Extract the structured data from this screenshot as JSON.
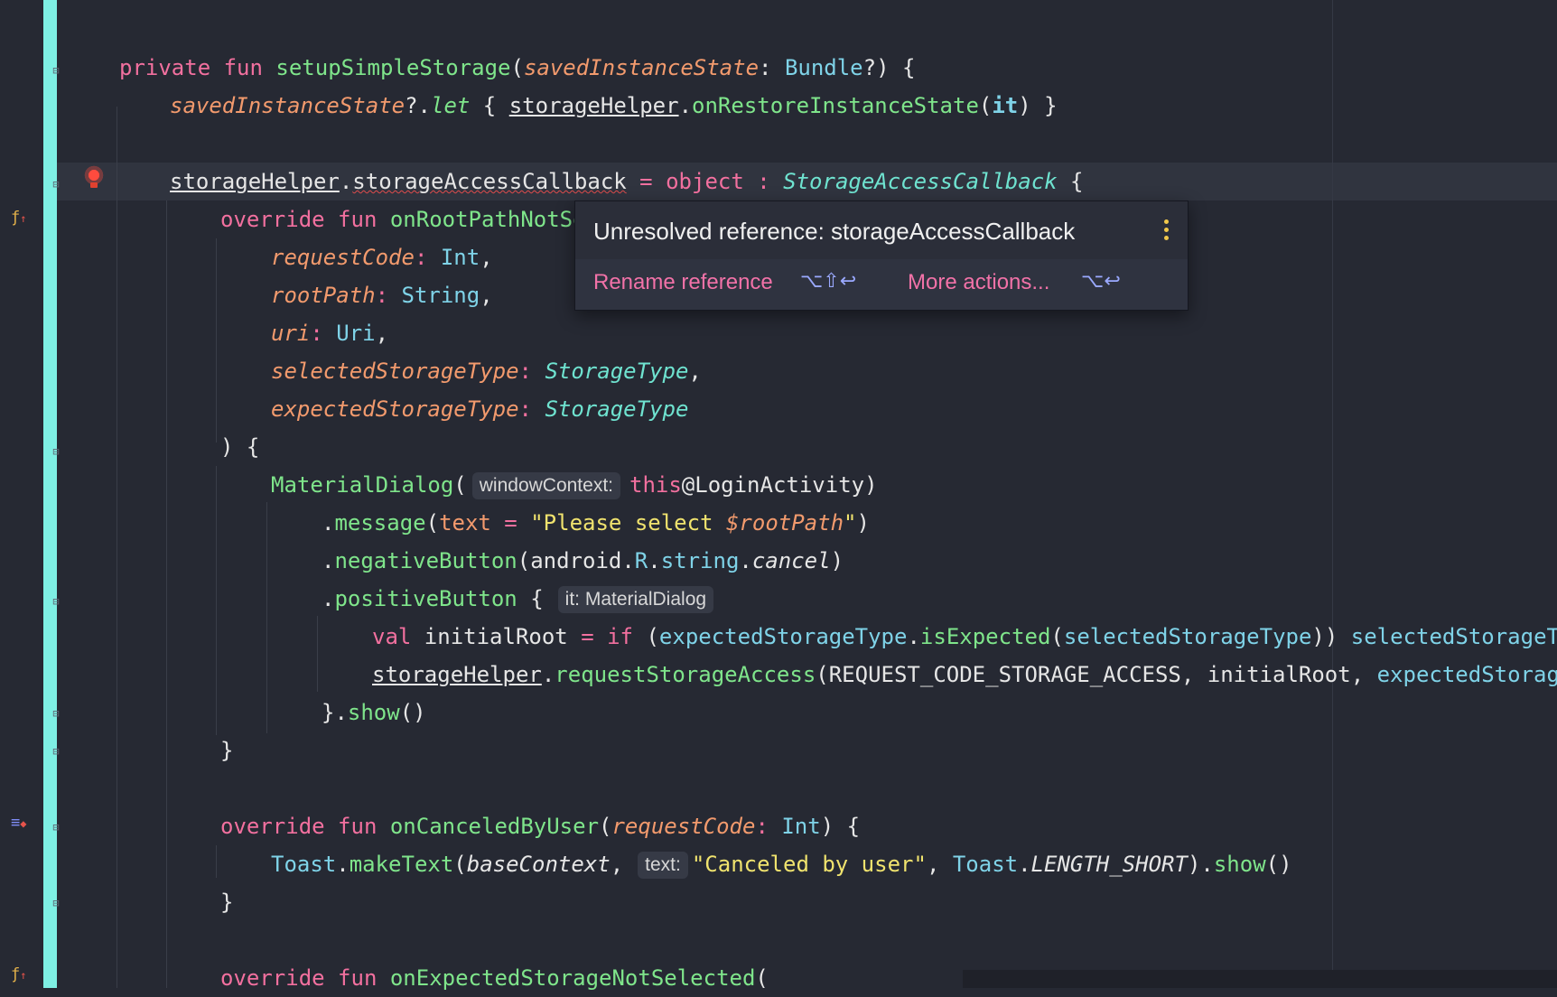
{
  "editor": {
    "lines": {
      "l1": {
        "kw": "private fun ",
        "fn": "setupSimpleStorage",
        "p1": "(",
        "param": "savedInstanceState",
        "p2": ": ",
        "type": "Bundle",
        "p3": "?) {"
      },
      "l2": {
        "param": "savedInstanceState",
        "op": "?.",
        "fn": "let",
        "p1": " { ",
        "ref": "storageHelper",
        "dot": ".",
        "fn2": "onRestoreInstanceState",
        "p2": "(",
        "it": "it",
        "p3": ") }"
      },
      "l3": {
        "ref": "storageHelper",
        "dot": ".",
        "err": "storageAccessCallback",
        "p1": " = ",
        "kw": "object",
        "p2": " : ",
        "type": "StorageAccessCallback",
        "p3": " {"
      },
      "l4": {
        "kw": "override fun ",
        "fn": "onRootPathNotSe"
      },
      "l5": {
        "param": "requestCode",
        "p1": ": ",
        "type": "Int",
        "p2": ","
      },
      "l6": {
        "param": "rootPath",
        "p1": ": ",
        "type": "String",
        "p2": ","
      },
      "l7": {
        "param": "uri",
        "p1": ": ",
        "type": "Uri",
        "p2": ","
      },
      "l8": {
        "param": "selectedStorageType",
        "p1": ": ",
        "type": "StorageType",
        "p2": ","
      },
      "l9": {
        "param": "expectedStorageType",
        "p1": ": ",
        "type": "StorageType"
      },
      "l10": {
        "text": ") {"
      },
      "l11": {
        "fn": "MaterialDialog",
        "p1": "(",
        "hint": "windowContext:",
        "kw": "this",
        "p2": "@LoginActivity)"
      },
      "l12": {
        "dot": ".",
        "fn": "message",
        "p1": "(",
        "param": "text",
        "p2": " = ",
        "str1": "\"Please select ",
        "tpl": "$rootPath",
        "str2": "\"",
        "p3": ")"
      },
      "l13": {
        "dot": ".",
        "fn": "negativeButton",
        "p1": "(android.",
        "t1": "R",
        "p2": ".",
        "t2": "string",
        "p3": ".",
        "it": "cancel",
        "p4": ")"
      },
      "l14": {
        "dot": ".",
        "fn": "positiveButton",
        "p1": " {",
        "hint": "it: MaterialDialog"
      },
      "l15": {
        "kw": "val",
        "p1": " initialRoot ",
        "op": "=",
        "p2": " ",
        "kw2": "if",
        "p3": " (",
        "t1": "expectedStorageType",
        "p4": ".",
        "fn": "isExpected",
        "p5": "(",
        "t2": "selectedStorageType",
        "p6": ")) ",
        "t3": "selectedStorageType"
      },
      "l16": {
        "ref": "storageHelper",
        "dot": ".",
        "fn": "requestStorageAccess",
        "p1": "(REQUEST_CODE_STORAGE_ACCESS, initialRoot, ",
        "t1": "expectedStorageTy"
      },
      "l17": {
        "p1": "}.",
        "fn": "show",
        "p2": "()"
      },
      "l18": {
        "text": "}"
      },
      "l19": {
        "kw": "override fun ",
        "fn": "onCanceledByUser",
        "p1": "(",
        "param": "requestCode",
        "p2": ": ",
        "type": "Int",
        "p3": ") {"
      },
      "l20": {
        "t1": "Toast",
        "p1": ".",
        "fn": "makeText",
        "p2": "(",
        "it": "baseContext",
        "p3": ",",
        "hint": "text:",
        "str": "\"Canceled by user\"",
        "p4": ", ",
        "t2": "Toast",
        "p5": ".",
        "it2": "LENGTH_SHORT",
        "p6": ").",
        "fn2": "show",
        "p7": "()"
      },
      "l21": {
        "text": "}"
      },
      "l22": {
        "kw": "override fun ",
        "fn": "onExpectedStorageNotSelected",
        "p1": "("
      }
    }
  },
  "popup": {
    "title": "Unresolved reference: storageAccessCallback",
    "action1": "Rename reference",
    "shortcut1": "⌥⇧↩",
    "action2": "More actions...",
    "shortcut2": "⌥↩"
  },
  "icons": {
    "gutter1": "override-icon",
    "gutter2": "implement-icon",
    "gutter3": "override-icon",
    "bulb": "error-bulb-icon",
    "more": "more-vertical-icon"
  }
}
